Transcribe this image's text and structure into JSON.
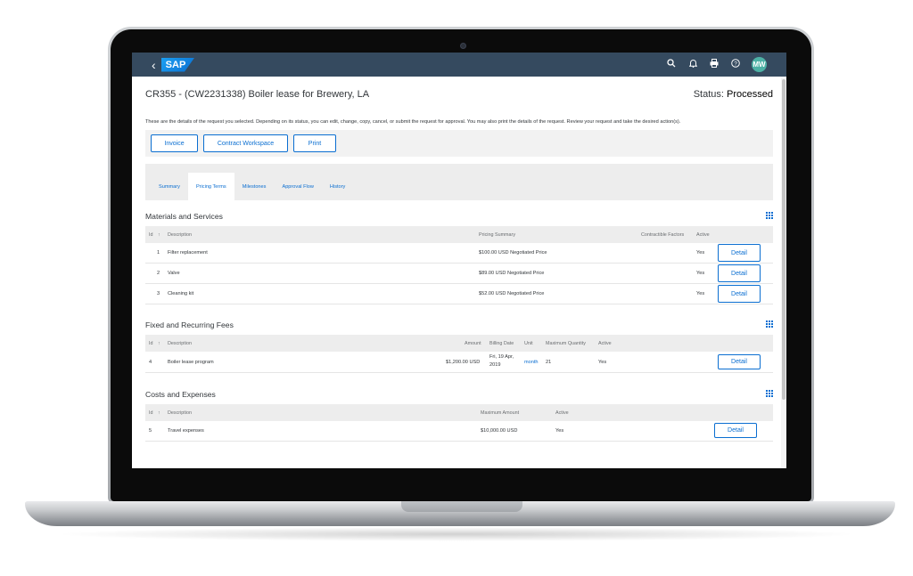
{
  "shell": {
    "back": "‹",
    "logo": "SAP",
    "icons": [
      "search-icon",
      "bell-icon",
      "print-icon",
      "help-icon"
    ],
    "avatar": "MW"
  },
  "page": {
    "title": "CR355 - (CW2231338) Boiler lease for Brewery, LA",
    "status_label": "Status:",
    "status_value": "Processed",
    "description": "These are the details of the request you selected. Depending on its status, you can edit, change, copy, cancel, or submit the request for approval. You may also print the details of the request. Review your request and take the desired action(s)."
  },
  "actions": {
    "invoice": "Invoice",
    "contract_workspace": "Contract Workspace",
    "print": "Print"
  },
  "tabs": [
    {
      "label": "Summary"
    },
    {
      "label": "Pricing Terms"
    },
    {
      "label": "Milestones"
    },
    {
      "label": "Approval Flow"
    },
    {
      "label": "History"
    }
  ],
  "materials": {
    "title": "Materials and Services",
    "headers": {
      "id": "Id",
      "sort": "↑",
      "description": "Description",
      "pricing": "Pricing Summary",
      "factors": "Contractible Factors",
      "active": "Active"
    },
    "rows": [
      {
        "id": "1",
        "description": "Filter replacement",
        "pricing": "$100.00 USD Negotiated Price",
        "active": "Yes",
        "action": "Detail"
      },
      {
        "id": "2",
        "description": "Valve",
        "pricing": "$89.00 USD Negotiated Price",
        "active": "Yes",
        "action": "Detail"
      },
      {
        "id": "3",
        "description": "Cleaning kit",
        "pricing": "$52.00 USD Negotiated Price",
        "active": "Yes",
        "action": "Detail"
      }
    ]
  },
  "fees": {
    "title": "Fixed and Recurring Fees",
    "headers": {
      "id": "Id",
      "sort": "↑",
      "description": "Description",
      "amount": "Amount",
      "billing": "Billing Date",
      "unit": "Unit",
      "max_qty": "Maximum Quantity",
      "active": "Active"
    },
    "rows": [
      {
        "id": "4",
        "description": "Boiler lease program",
        "amount": "$1,200.00 USD",
        "billing_line1": "Fri, 19 Apr,",
        "billing_line2": "2019",
        "unit": "month",
        "max_qty": "21",
        "active": "Yes",
        "action": "Detail"
      }
    ]
  },
  "costs": {
    "title": "Costs and Expenses",
    "headers": {
      "id": "Id",
      "sort": "↑",
      "description": "Description",
      "max_amount": "Maximum Amount",
      "active": "Active"
    },
    "rows": [
      {
        "id": "5",
        "description": "Travel expenses",
        "max_amount": "$10,000.00 USD",
        "active": "Yes",
        "action": "Detail"
      }
    ]
  },
  "colors": {
    "shell": "#354a5f",
    "accent": "#0a6ed1",
    "avatar": "#4db1a5"
  }
}
